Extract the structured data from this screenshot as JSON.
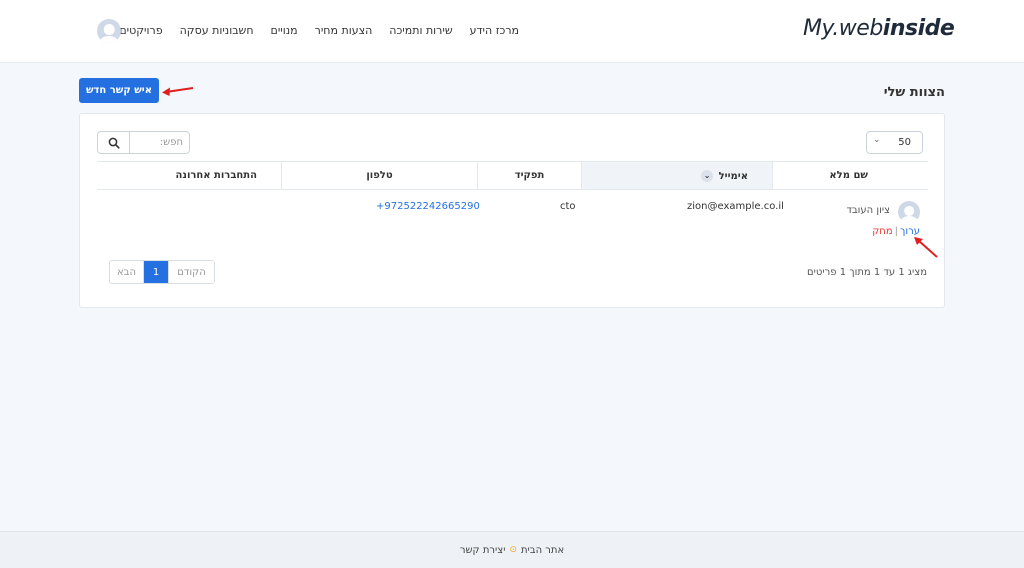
{
  "app": {
    "logo_prefix": "My.",
    "logo_web": "web",
    "logo_inside": "inside"
  },
  "nav": {
    "items": [
      "פרויקטים",
      "חשבוניות עסקה",
      "מנויים",
      "הצעות מחיר",
      "שירות ותמיכה",
      "מרכז הידע"
    ]
  },
  "page": {
    "title": "הצוות שלי",
    "new_contact_label": "איש קשר חדש"
  },
  "toolbar": {
    "per_page": "50",
    "search_placeholder": "חפש:"
  },
  "table": {
    "headers": {
      "name": "שם מלא",
      "email": "אימייל",
      "role": "תפקיד",
      "phone": "טלפון",
      "last_login": "התחברות אחרונה"
    },
    "rows": [
      {
        "name": "ציון העובד",
        "email": "zion@example.co.il",
        "role": "cto",
        "phone": "+972522242665290",
        "last_login": "",
        "edit_label": "ערוך",
        "delete_label": "מחק"
      }
    ]
  },
  "pagination": {
    "info": "מציג 1 עד 1 מתוך 1 פריטים",
    "prev_label": "הקודם",
    "current": "1",
    "next_label": "הבא"
  },
  "footer": {
    "home_label": "אתר הבית",
    "contact_label": "יצירת קשר"
  },
  "colors": {
    "accent": "#2470e0",
    "danger": "#e53935",
    "annotation_arrow": "#e02020"
  },
  "icons": {
    "search": "search-icon",
    "chevron": "chevron-down-icon",
    "sort": "sort-arrow-icon",
    "avatar": "user-avatar-icon"
  }
}
